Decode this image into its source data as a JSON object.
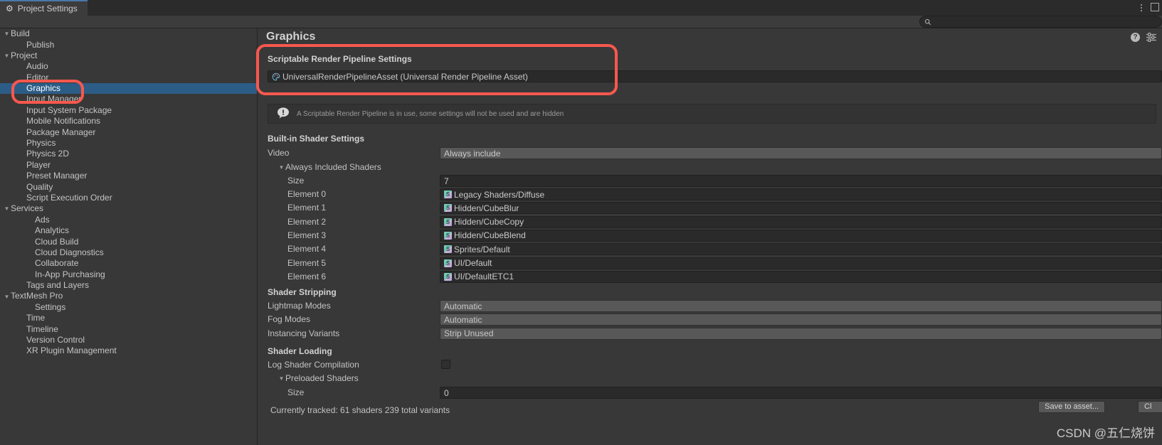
{
  "window": {
    "tab_label": "Project Settings",
    "tab_icon": "gear-icon",
    "kebab_icon": "kebab-menu-icon",
    "maximize_icon": "maximize-icon"
  },
  "search": {
    "value": "",
    "placeholder": "",
    "icon": "search-icon"
  },
  "sidebar": {
    "items": [
      {
        "label": "Build",
        "depth": 0,
        "arrow": "▼",
        "selected": false
      },
      {
        "label": "Publish",
        "depth": 1,
        "arrow": "",
        "selected": false
      },
      {
        "label": "Project",
        "depth": 0,
        "arrow": "▼",
        "selected": false
      },
      {
        "label": "Audio",
        "depth": 1,
        "arrow": "",
        "selected": false
      },
      {
        "label": "Editor",
        "depth": 1,
        "arrow": "",
        "selected": false
      },
      {
        "label": "Graphics",
        "depth": 1,
        "arrow": "",
        "selected": true
      },
      {
        "label": "Input Manager",
        "depth": 1,
        "arrow": "",
        "selected": false
      },
      {
        "label": "Input System Package",
        "depth": 1,
        "arrow": "",
        "selected": false
      },
      {
        "label": "Mobile Notifications",
        "depth": 1,
        "arrow": "",
        "selected": false
      },
      {
        "label": "Package Manager",
        "depth": 1,
        "arrow": "",
        "selected": false
      },
      {
        "label": "Physics",
        "depth": 1,
        "arrow": "",
        "selected": false
      },
      {
        "label": "Physics 2D",
        "depth": 1,
        "arrow": "",
        "selected": false
      },
      {
        "label": "Player",
        "depth": 1,
        "arrow": "",
        "selected": false
      },
      {
        "label": "Preset Manager",
        "depth": 1,
        "arrow": "",
        "selected": false
      },
      {
        "label": "Quality",
        "depth": 1,
        "arrow": "",
        "selected": false
      },
      {
        "label": "Script Execution Order",
        "depth": 1,
        "arrow": "",
        "selected": false
      },
      {
        "label": "Services",
        "depth": 0,
        "arrow": "▼",
        "selected": false
      },
      {
        "label": "Ads",
        "depth": 2,
        "arrow": "",
        "selected": false
      },
      {
        "label": "Analytics",
        "depth": 2,
        "arrow": "",
        "selected": false
      },
      {
        "label": "Cloud Build",
        "depth": 2,
        "arrow": "",
        "selected": false
      },
      {
        "label": "Cloud Diagnostics",
        "depth": 2,
        "arrow": "",
        "selected": false
      },
      {
        "label": "Collaborate",
        "depth": 2,
        "arrow": "",
        "selected": false
      },
      {
        "label": "In-App Purchasing",
        "depth": 2,
        "arrow": "",
        "selected": false
      },
      {
        "label": "Tags and Layers",
        "depth": 1,
        "arrow": "",
        "selected": false
      },
      {
        "label": "TextMesh Pro",
        "depth": 0,
        "arrow": "▼",
        "selected": false
      },
      {
        "label": "Settings",
        "depth": 2,
        "arrow": "",
        "selected": false
      },
      {
        "label": "Time",
        "depth": 1,
        "arrow": "",
        "selected": false
      },
      {
        "label": "Timeline",
        "depth": 1,
        "arrow": "",
        "selected": false
      },
      {
        "label": "Version Control",
        "depth": 1,
        "arrow": "",
        "selected": false
      },
      {
        "label": "XR Plugin Management",
        "depth": 1,
        "arrow": "",
        "selected": false
      }
    ]
  },
  "header": {
    "title": "Graphics",
    "help_icon": "help-icon",
    "help_glyph": "?",
    "preset_icon": "preset-settings-icon"
  },
  "srp": {
    "section_label": "Scriptable Render Pipeline Settings",
    "asset_value": "UniversalRenderPipelineAsset (Universal Render Pipeline Asset)",
    "asset_icon": "render-pipeline-asset-icon",
    "notice_text": "A Scriptable Render Pipeline is in use, some settings will not be used and are hidden",
    "notice_icon": "info-balloon-icon"
  },
  "builtin": {
    "section_label": "Built-in Shader Settings",
    "video_label": "Video",
    "video_value": "Always include",
    "always_included_label": "Always Included Shaders",
    "always_included_arrow": "▼",
    "size_label": "Size",
    "size_value": "7",
    "elements": [
      {
        "label": "Element 0",
        "value": "Legacy Shaders/Diffuse",
        "icon": "shader-icon"
      },
      {
        "label": "Element 1",
        "value": "Hidden/CubeBlur",
        "icon": "shader-icon"
      },
      {
        "label": "Element 2",
        "value": "Hidden/CubeCopy",
        "icon": "shader-icon"
      },
      {
        "label": "Element 3",
        "value": "Hidden/CubeBlend",
        "icon": "shader-icon"
      },
      {
        "label": "Element 4",
        "value": "Sprites/Default",
        "icon": "shader-icon"
      },
      {
        "label": "Element 5",
        "value": "UI/Default",
        "icon": "shader-icon"
      },
      {
        "label": "Element 6",
        "value": "UI/DefaultETC1",
        "icon": "shader-icon"
      }
    ]
  },
  "stripping": {
    "section_label": "Shader Stripping",
    "rows": [
      {
        "label": "Lightmap Modes",
        "value": "Automatic"
      },
      {
        "label": "Fog Modes",
        "value": "Automatic"
      },
      {
        "label": "Instancing Variants",
        "value": "Strip Unused"
      }
    ]
  },
  "loading": {
    "section_label": "Shader Loading",
    "log_label": "Log Shader Compilation",
    "log_checked": false,
    "preloaded_label": "Preloaded Shaders",
    "preloaded_arrow": "▼",
    "size_label": "Size",
    "size_value": "0",
    "tracked_text": "Currently tracked: 61 shaders 239 total variants"
  },
  "footer": {
    "save_label": "Save to asset...",
    "clear_label": "Cl"
  },
  "watermark": "CSDN @五仁烧饼",
  "colors": {
    "window_bg": "#383838",
    "tabbar_bg": "#2b2b2b",
    "selection_blue": "#2c5d87",
    "annotation_red": "#f9584e",
    "field_dark": "#2a2a2a",
    "popup_gray": "#585858"
  }
}
